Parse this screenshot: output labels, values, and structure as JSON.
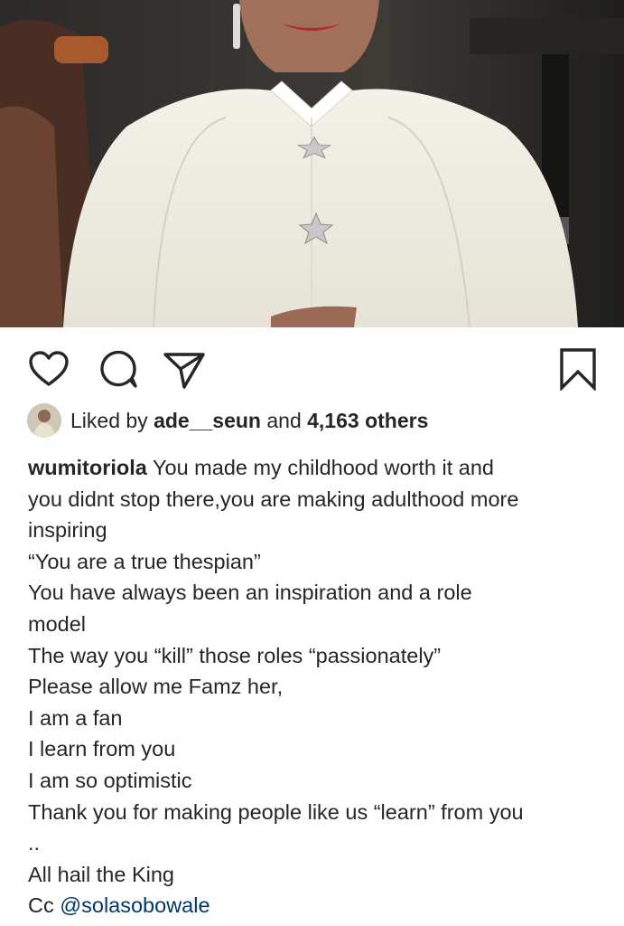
{
  "post": {
    "image_alt": "Woman in white dress with star brooches",
    "accent_link_color": "#00376b"
  },
  "actions": {
    "like_icon": "heart-icon",
    "comment_icon": "comment-icon",
    "share_icon": "paper-plane-icon",
    "save_icon": "bookmark-icon"
  },
  "likes": {
    "prefix": "Liked by",
    "user": "ade__seun",
    "connector": "and",
    "others": "4,163 others"
  },
  "caption": {
    "username": "wumitoriola",
    "first_line_rest": "You made my childhood worth it and",
    "lines": [
      "you didnt stop there,you are making adulthood more",
      "inspiring",
      "“You are a true thespian”",
      "You have always been an inspiration and a role",
      "model",
      "The way you “kill” those roles “passionately”",
      "Please allow me Famz her,",
      "I am a fan",
      "I learn from you",
      "I am so optimistic",
      "Thank you for making people like us “learn” from you",
      "..",
      "All hail the King"
    ],
    "cc_prefix": "Cc",
    "mention": "@solasobowale"
  }
}
